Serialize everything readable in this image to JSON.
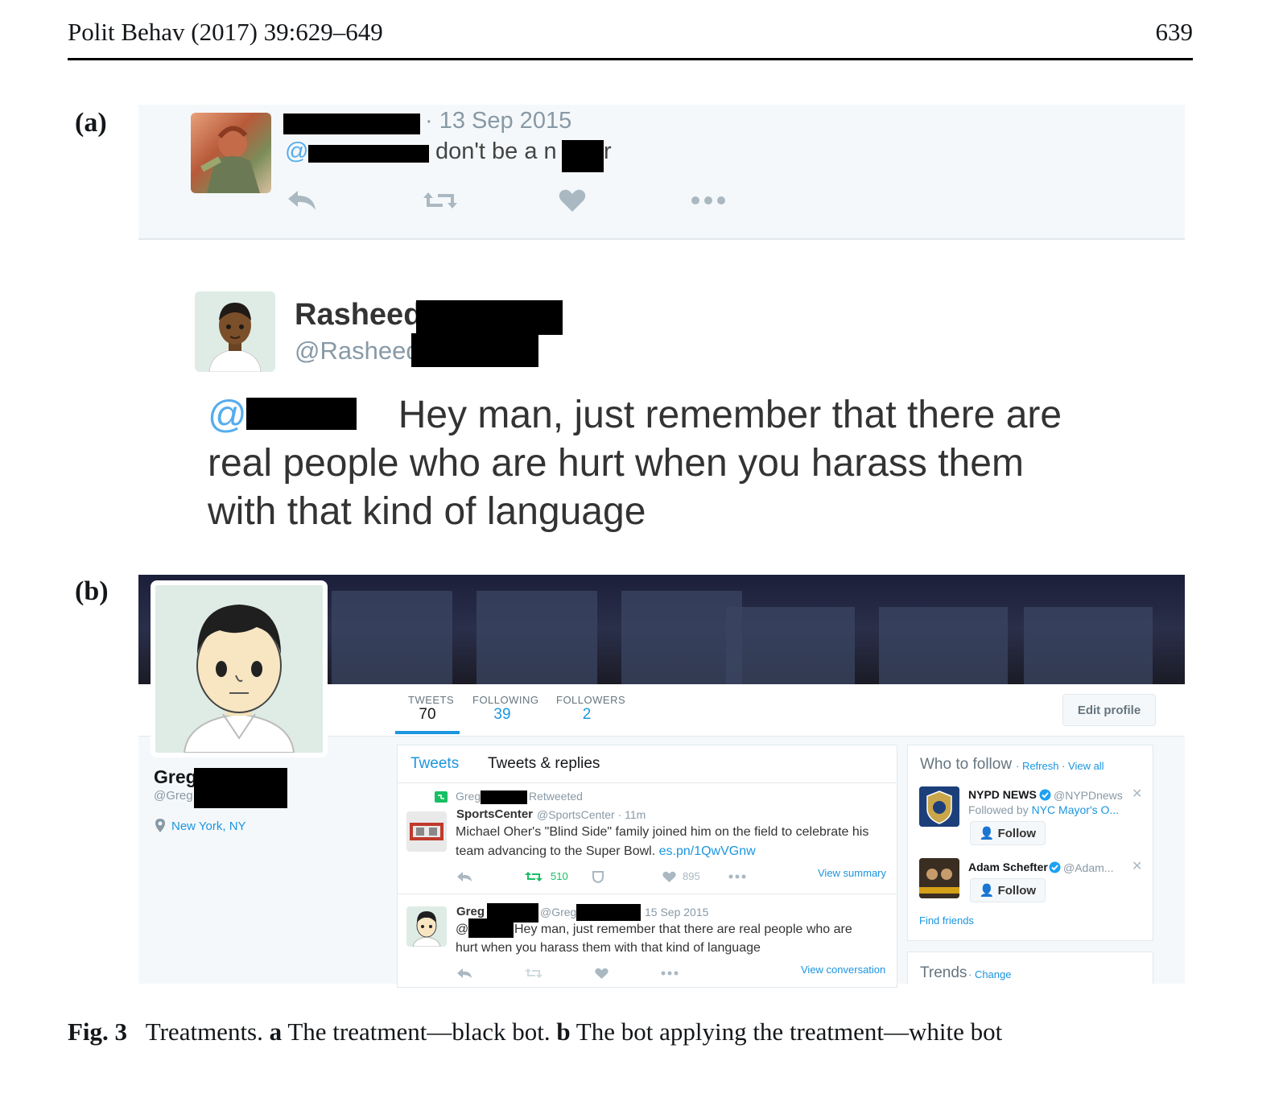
{
  "header": {
    "running_head": "Polit Behav (2017) 39:629–649",
    "page_number": "639"
  },
  "panel_a": {
    "label": "(a)",
    "tweet": {
      "date": "· 13 Sep 2015",
      "at": "@",
      "text_part1": "don't be a n",
      "text_part2": "r"
    },
    "reply": {
      "name": "Rasheed",
      "handle": "@Rasheed",
      "at": "@",
      "text": "Hey man, just remember that there are real people who are hurt when you harass them with that kind of language"
    }
  },
  "panel_b": {
    "label": "(b)",
    "profile": {
      "name": "Greg",
      "handle": "@Greg",
      "location": "New York, NY"
    },
    "stats": [
      {
        "label": "TWEETS",
        "value": "70"
      },
      {
        "label": "FOLLOWING",
        "value": "39"
      },
      {
        "label": "FOLLOWERS",
        "value": "2"
      }
    ],
    "edit_profile": "Edit profile",
    "tabs": {
      "tweets": "Tweets",
      "replies": "Tweets & replies"
    },
    "tweet1": {
      "retweeter": "Greg",
      "retweeted": "Retweeted",
      "author": "SportsCenter",
      "author_meta": "@SportsCenter · 11m",
      "text": "Michael Oher's \"Blind Side\" family joined him on the field to celebrate his team advancing to the Super Bowl.",
      "link": "es.pn/1QwVGnw",
      "retweets": "510",
      "likes": "895",
      "view_summary": "View summary"
    },
    "tweet2": {
      "author": "Greg",
      "handle": "@Greg",
      "date": "15 Sep 2015",
      "at": "@",
      "text_line1": "Hey man, just remember that there are real people who are",
      "text_line2": "hurt when you harass them with that kind of language",
      "view_conversation": "View conversation"
    },
    "who_to_follow": {
      "title": "Who to follow",
      "refresh": "· Refresh · View all",
      "accounts": [
        {
          "name": "NYPD NEWS",
          "handle": "@NYPDnews",
          "followed_by_prefix": "Followed by",
          "followed_by": "NYC Mayor's O...",
          "button": "Follow"
        },
        {
          "name": "Adam Schefter",
          "handle": "@Adam...",
          "button": "Follow"
        }
      ],
      "find_friends": "Find friends"
    },
    "trends": {
      "title": "Trends",
      "change": "· Change"
    }
  },
  "caption": {
    "fig": "Fig. 3",
    "prefix": "Treatments.",
    "a": "a",
    "a_text": "The treatment—black bot.",
    "b": "b",
    "b_text": "The bot applying the treatment—white bot"
  },
  "colors": {
    "twitter_blue": "#1b95e0",
    "light_blue": "#55acee",
    "panel_bg": "#f5f8fa",
    "retweet_green": "#17bf63"
  }
}
